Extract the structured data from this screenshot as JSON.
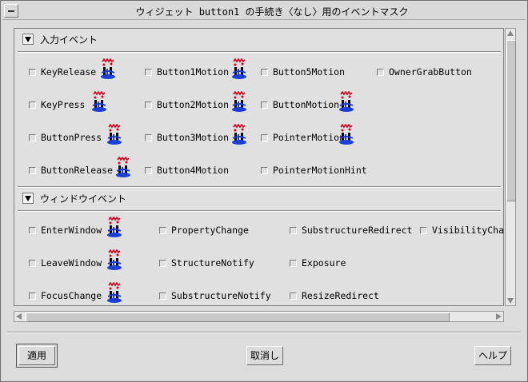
{
  "window": {
    "title": "ウィジェット button1 の手続き〈なし〉用のイベントマスク"
  },
  "sections": [
    {
      "label": "入力イベント",
      "items": [
        {
          "label": "KeyRelease",
          "icon": true
        },
        {
          "label": "Button1Motion",
          "icon": true
        },
        {
          "label": "Button5Motion",
          "icon": false
        },
        {
          "label": "OwnerGrabButton",
          "icon": false
        },
        {
          "label": "KeyPress",
          "icon": true
        },
        {
          "label": "Button2Motion",
          "icon": true
        },
        {
          "label": "ButtonMotion",
          "icon": true
        },
        {
          "label": "ButtonPress",
          "icon": true
        },
        {
          "label": "Button3Motion",
          "icon": true
        },
        {
          "label": "PointerMotion",
          "icon": true
        },
        {
          "label": "ButtonRelease",
          "icon": true
        },
        {
          "label": "Button4Motion",
          "icon": false
        },
        {
          "label": "PointerMotionHint",
          "icon": false
        }
      ]
    },
    {
      "label": "ウィンドウイベント",
      "items": [
        {
          "label": "EnterWindow",
          "icon": true
        },
        {
          "label": "PropertyChange",
          "icon": false
        },
        {
          "label": "SubstructureRedirect",
          "icon": false
        },
        {
          "label": "VisibilityChange",
          "icon": false
        },
        {
          "label": "LeaveWindow",
          "icon": true
        },
        {
          "label": "StructureNotify",
          "icon": false
        },
        {
          "label": "Exposure",
          "icon": false
        },
        {
          "label": "FocusChange",
          "icon": true
        },
        {
          "label": "SubstructureNotify",
          "icon": false
        },
        {
          "label": "ResizeRedirect",
          "icon": false
        }
      ]
    }
  ],
  "buttons": {
    "apply": "適用",
    "cancel": "取消し",
    "help": "ヘルプ"
  },
  "colors": {
    "background": "#dcdcdc",
    "panel": "#e0e0e0",
    "icon_blue": "#1b3fd6",
    "icon_red": "#d4001c"
  }
}
